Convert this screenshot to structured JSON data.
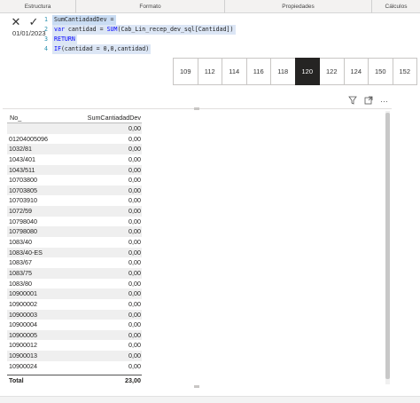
{
  "ribbon": {
    "groups": [
      "Estructura",
      "Formato",
      "Propiedades",
      "Cálculos"
    ]
  },
  "formula_bar": {
    "cancel_icon": "close-icon",
    "commit_icon": "check-icon",
    "date_text": "01/01/2023",
    "lines": [
      {
        "num": "1",
        "text": "SumCantiadadDev ="
      },
      {
        "num": "2",
        "parts": [
          {
            "t": "var",
            "k": "kw"
          },
          {
            "t": " cantidad = ",
            "k": "plain"
          },
          {
            "t": "SUM",
            "k": "fn"
          },
          {
            "t": "(Cab_Lin_recep_dev_sql[Cantidad])",
            "k": "plain"
          }
        ]
      },
      {
        "num": "3",
        "parts": [
          {
            "t": "RETURN",
            "k": "kw"
          }
        ]
      },
      {
        "num": "4",
        "parts": [
          {
            "t": "IF",
            "k": "fn"
          },
          {
            "t": "(cantidad = 0,0,cantidad)",
            "k": "plain"
          }
        ]
      }
    ]
  },
  "slicer": {
    "items": [
      "109",
      "112",
      "114",
      "116",
      "118",
      "120",
      "122",
      "124",
      "150",
      "152"
    ],
    "selected": "120"
  },
  "visual_header": {
    "icons": [
      "filter-icon",
      "focus-mode-icon",
      "more-options-icon"
    ]
  },
  "table": {
    "columns": [
      "No_",
      "SumCantiadadDev"
    ],
    "rows": [
      [
        "",
        "0,00"
      ],
      [
        "01204005096",
        "0,00"
      ],
      [
        "1032/81",
        "0,00"
      ],
      [
        "1043/401",
        "0,00"
      ],
      [
        "1043/511",
        "0,00"
      ],
      [
        "10703800",
        "0,00"
      ],
      [
        "10703805",
        "0,00"
      ],
      [
        "10703910",
        "0,00"
      ],
      [
        "1072/59",
        "0,00"
      ],
      [
        "10798040",
        "0,00"
      ],
      [
        "10798080",
        "0,00"
      ],
      [
        "1083/40",
        "0,00"
      ],
      [
        "1083/40-ES",
        "0,00"
      ],
      [
        "1083/67",
        "0,00"
      ],
      [
        "1083/75",
        "0,00"
      ],
      [
        "1083/80",
        "0,00"
      ],
      [
        "10900001",
        "0,00"
      ],
      [
        "10900002",
        "0,00"
      ],
      [
        "10900003",
        "0,00"
      ],
      [
        "10900004",
        "0,00"
      ],
      [
        "10900005",
        "0,00"
      ],
      [
        "10900012",
        "0,00"
      ],
      [
        "10900013",
        "0,00"
      ],
      [
        "10900024",
        "0,00"
      ]
    ],
    "total": [
      "Total",
      "23,00"
    ]
  }
}
